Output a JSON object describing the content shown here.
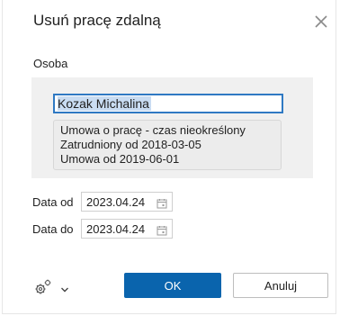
{
  "dialog": {
    "title": "Usuń pracę zdalną",
    "close_icon": "close-icon"
  },
  "person": {
    "section_label": "Osoba",
    "name_value": "Kozak Michalina",
    "info_lines": [
      "Umowa o pracę - czas nieokreślony",
      "Zatrudniony od 2018-03-05",
      "Umowa od 2019-06-01"
    ]
  },
  "dates": {
    "from_label": "Data od",
    "from_value": "2023.04.24",
    "to_label": "Data do",
    "to_value": "2023.04.24",
    "calendar_icon": "calendar-icon"
  },
  "footer": {
    "settings_icon": "gear-icon",
    "menu_icon": "chevron-down-icon",
    "ok_label": "OK",
    "cancel_label": "Anuluj"
  },
  "colors": {
    "primary_button": "#0a64ad",
    "focus_border": "#2f79c3",
    "selection": "#c9dcf2"
  }
}
